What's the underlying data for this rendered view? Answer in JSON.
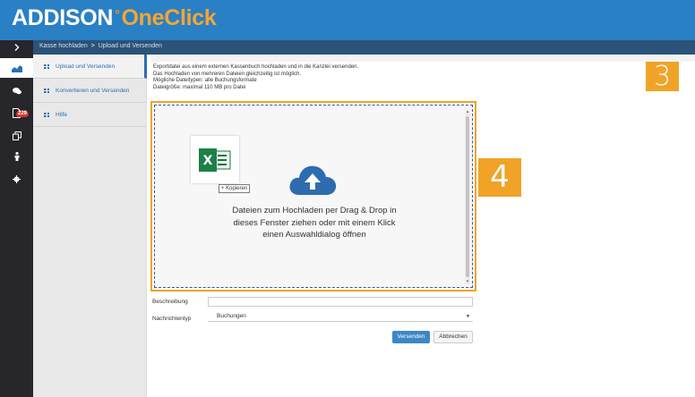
{
  "brand": {
    "name_part1": "ADDISON",
    "separator": "°",
    "name_part2": "OneClick",
    "colors": {
      "primary": "#2980c4",
      "accent": "#f6a534"
    }
  },
  "breadcrumb": {
    "toggle_icon": "chevron-right-icon",
    "parent": "Kasse hochladen",
    "separator": ">",
    "current": "Upload und Versenden"
  },
  "rail": {
    "items": [
      {
        "icon": "chart-icon",
        "active": true
      },
      {
        "icon": "chat-icon",
        "active": false
      },
      {
        "icon": "document-icon",
        "active": false,
        "badge": "229"
      },
      {
        "icon": "copy-icon",
        "active": false
      },
      {
        "icon": "person-icon",
        "active": false
      },
      {
        "icon": "gear-icon",
        "active": false
      }
    ]
  },
  "subnav": {
    "items": [
      {
        "label": "Upload und Versenden",
        "icon": "grid-icon",
        "active": true
      },
      {
        "label": "Konvertieren und Versenden",
        "icon": "grid-icon",
        "active": false
      },
      {
        "label": "Hilfe",
        "icon": "grid-icon",
        "active": false
      }
    ]
  },
  "info": {
    "line1": "Exportdatei aus einem externen Kassenbuch hochladen und in die Kanzlei versenden.",
    "line2": "Das Hochladen von mehreren Dateien gleichzeitig ist möglich.",
    "line3": "Mögliche Dateitypen: alle Buchungsformate",
    "line4": "Dateigröße: maximal 110 MB pro Datei"
  },
  "callouts": {
    "three": "3",
    "four": "4"
  },
  "dropzone": {
    "file_icon": "excel-file-icon",
    "copy_label": "+ Kopieren",
    "upload_icon": "cloud-upload-icon",
    "text_line1": "Dateien zum Hochladen per Drag & Drop in",
    "text_line2": "dieses Fenster ziehen oder mit einem Klick",
    "text_line3": "einen Auswahldialog öffnen"
  },
  "form": {
    "description_label": "Beschreibung",
    "description_value": "",
    "message_type_label": "Nachrichtentyp",
    "message_type_value": "Buchungen"
  },
  "buttons": {
    "send": "Versenden",
    "cancel": "Abbrechen"
  }
}
